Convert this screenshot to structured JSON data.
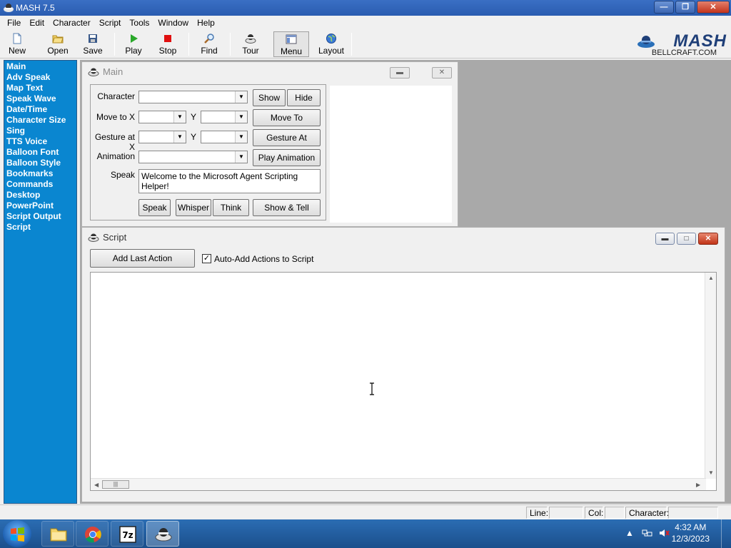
{
  "window": {
    "title": "MASH 7.5"
  },
  "menubar": {
    "items": [
      {
        "label": "File"
      },
      {
        "label": "Edit"
      },
      {
        "label": "Character"
      },
      {
        "label": "Script"
      },
      {
        "label": "Tools"
      },
      {
        "label": "Window"
      },
      {
        "label": "Help"
      }
    ]
  },
  "toolbar": {
    "new": "New",
    "open": "Open",
    "save": "Save",
    "play": "Play",
    "stop": "Stop",
    "find": "Find",
    "tour": "Tour",
    "menu": "Menu",
    "layout": "Layout"
  },
  "brand": {
    "name": "MASH",
    "site": "BELLCRAFT.COM"
  },
  "sidebar": {
    "items": [
      {
        "label": "Main"
      },
      {
        "label": "Adv Speak"
      },
      {
        "label": "Map Text"
      },
      {
        "label": "Speak Wave"
      },
      {
        "label": "Date/Time"
      },
      {
        "label": "Character Size"
      },
      {
        "label": "Sing"
      },
      {
        "label": "TTS Voice"
      },
      {
        "label": "Balloon Font"
      },
      {
        "label": "Balloon Style"
      },
      {
        "label": "Bookmarks"
      },
      {
        "label": "Commands"
      },
      {
        "label": "Desktop"
      },
      {
        "label": "PowerPoint"
      },
      {
        "label": "Script Output"
      },
      {
        "label": "Script"
      }
    ]
  },
  "main_window": {
    "title": "Main",
    "character_label": "Character",
    "character_value": "",
    "move_label": "Move to X",
    "move_x": "",
    "move_y_label": "Y",
    "move_y": "",
    "gesture_label": "Gesture at X",
    "gesture_x": "",
    "gesture_y_label": "Y",
    "gesture_y": "",
    "animation_label": "Animation",
    "animation_value": "",
    "speak_label": "Speak",
    "speak_text": "Welcome to the Microsoft Agent Scripting Helper!",
    "buttons": {
      "show": "Show",
      "hide": "Hide",
      "move_to": "Move To",
      "gesture_at": "Gesture At",
      "play_animation": "Play Animation",
      "speak": "Speak",
      "whisper": "Whisper",
      "think": "Think",
      "show_tell": "Show & Tell"
    }
  },
  "script_window": {
    "title": "Script",
    "add_last_action": "Add Last Action",
    "auto_add_label": "Auto-Add Actions to Script",
    "auto_add_checked": true,
    "script_text": ""
  },
  "statusbar": {
    "line_label": "Line:",
    "line_value": "",
    "col_label": "Col:",
    "col_value": "",
    "character_label": "Character:",
    "character_value": ""
  },
  "taskbar": {
    "items": [
      "windows-explorer",
      "chrome",
      "7-zip",
      "mash"
    ],
    "time": "4:32 AM",
    "date": "12/3/2023"
  }
}
